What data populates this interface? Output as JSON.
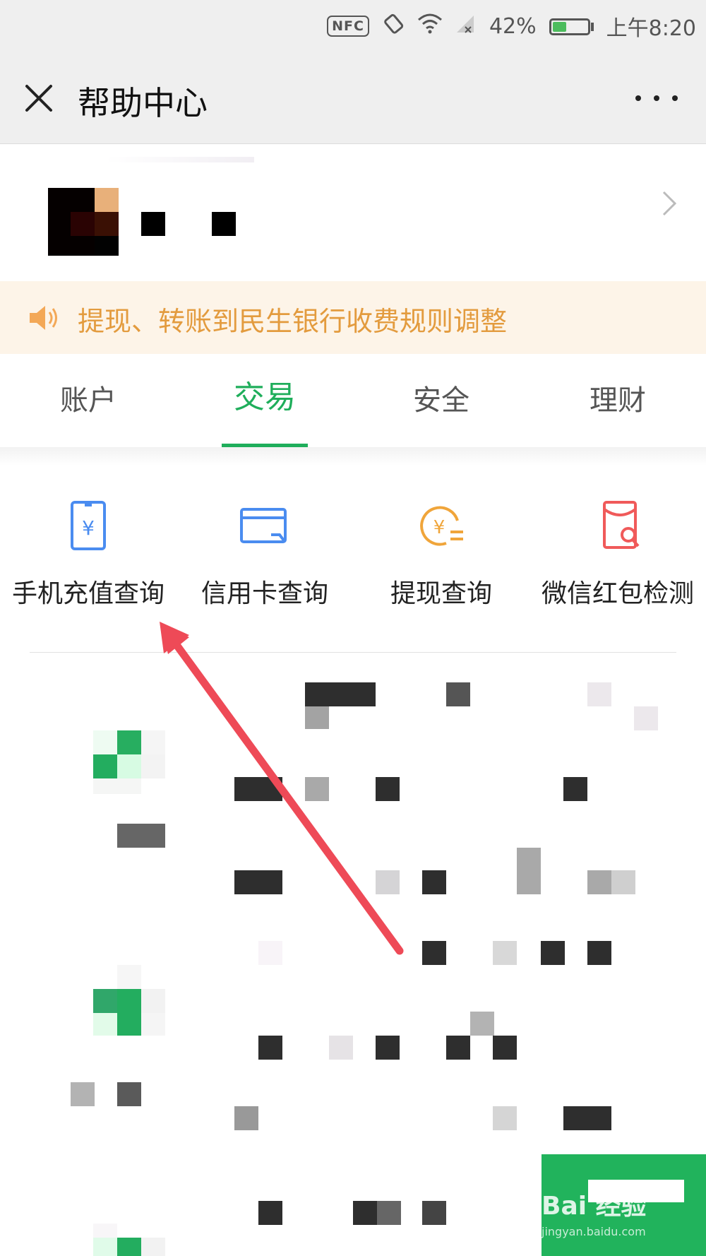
{
  "status_bar": {
    "nfc": "NFC",
    "battery_percent": "42%",
    "battery_level": 0.42,
    "time": "上午8:20"
  },
  "header": {
    "title": "帮助中心"
  },
  "notice": {
    "text": "提现、转账到民生银行收费规则调整",
    "accent_color": "#e39b3e"
  },
  "tabs": [
    {
      "label": "账户",
      "active": false
    },
    {
      "label": "交易",
      "active": true
    },
    {
      "label": "安全",
      "active": false
    },
    {
      "label": "理财",
      "active": false
    }
  ],
  "tools": [
    {
      "label": "手机充值查询",
      "icon": "phone-yuan-icon",
      "color": "#4a8cf0"
    },
    {
      "label": "信用卡查询",
      "icon": "credit-card-icon",
      "color": "#4a8cf0"
    },
    {
      "label": "提现查询",
      "icon": "coin-withdraw-icon",
      "color": "#f0a53a"
    },
    {
      "label": "微信红包检测",
      "icon": "red-packet-search-icon",
      "color": "#f05a5a"
    }
  ],
  "theme": {
    "active_tab_color": "#1fae5b",
    "annotation_arrow_color": "#ee4a57"
  },
  "watermark": {
    "text": "Bai 经验",
    "sub": "jingyan.baidu.com"
  }
}
